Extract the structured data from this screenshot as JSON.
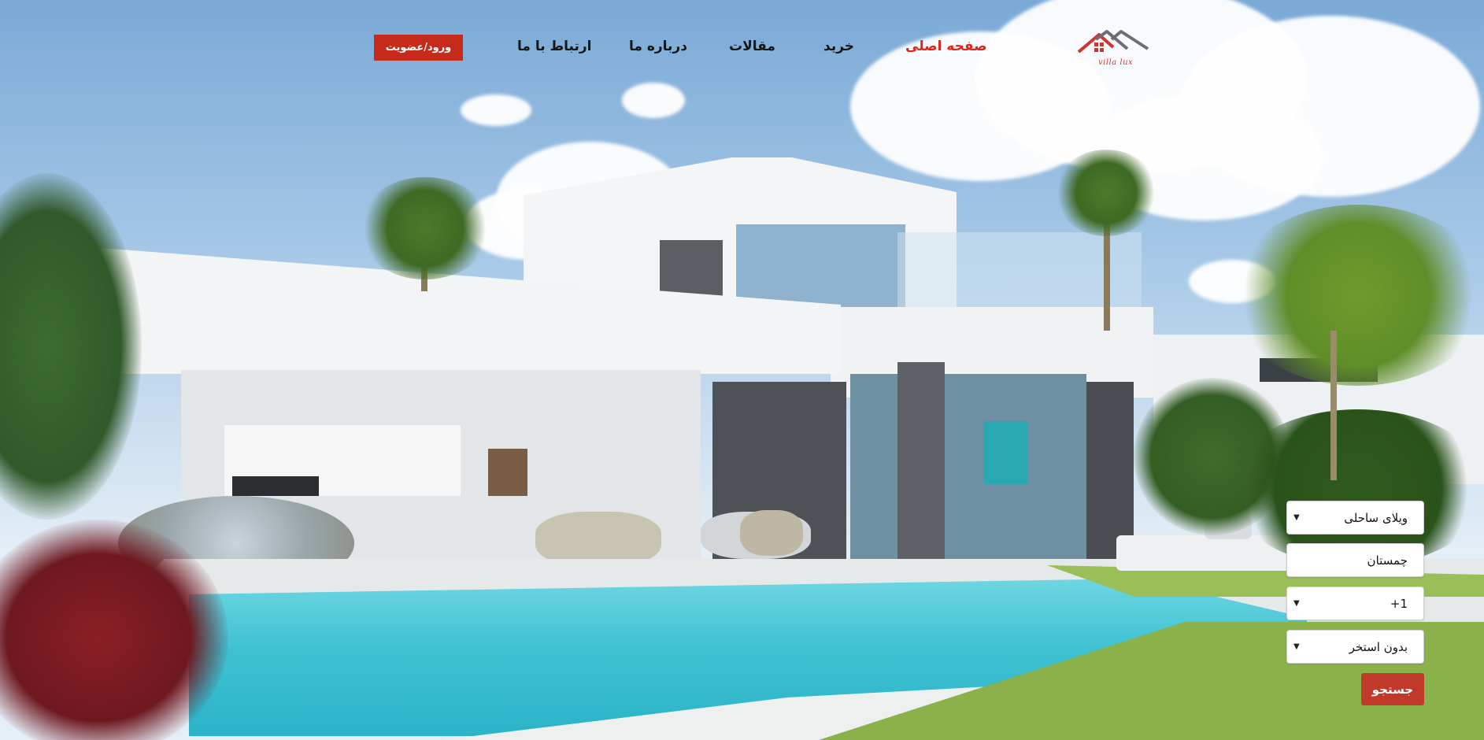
{
  "brand": {
    "logo_text": "villa lux"
  },
  "nav": {
    "items": [
      {
        "label": "صفحه اصلی",
        "active": true
      },
      {
        "label": "خرید",
        "active": false
      },
      {
        "label": "مقالات",
        "active": false
      },
      {
        "label": "درباره ما",
        "active": false
      },
      {
        "label": "ارتباط با ما",
        "active": false
      }
    ],
    "login_label": "ورود/عضویت"
  },
  "search": {
    "type_value": "ویلای ساحلی",
    "location_value": "چمستان",
    "rooms_value": "1+",
    "pool_value": "بدون استخر",
    "button_label": "جستجو"
  },
  "colors": {
    "accent": "#e0261b",
    "button": "#c52a1b",
    "search_button": "#c0392b"
  }
}
